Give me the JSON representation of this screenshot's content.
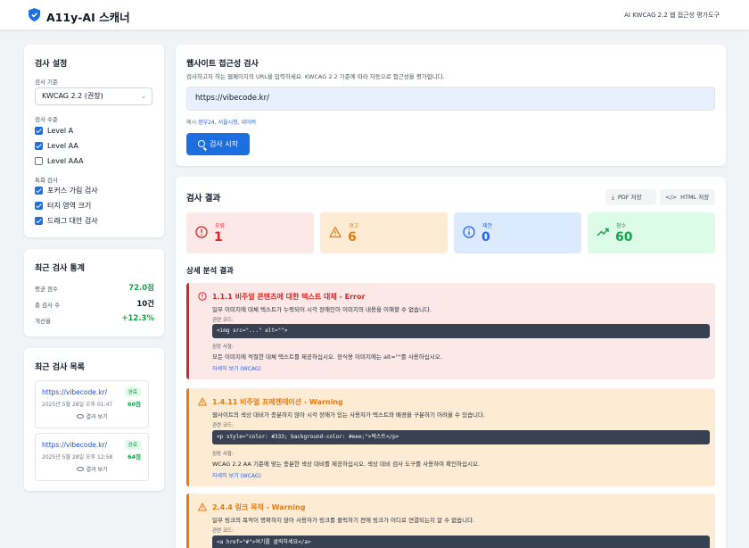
{
  "header": {
    "title": "A11y-AI 스캐너",
    "subtitle": "AI KWCAG 2.2 웹 접근성 평가도구"
  },
  "settings": {
    "title": "검사 설정",
    "standard_label": "검사 기준",
    "standard_value": "KWCAG 2.2 (권장)",
    "level_label": "검사 수준",
    "levels": [
      {
        "label": "Level A",
        "checked": true
      },
      {
        "label": "Level AA",
        "checked": true
      },
      {
        "label": "Level AAA",
        "checked": false
      }
    ],
    "special_label": "특화 검사",
    "specials": [
      {
        "label": "포커스 가림 검사",
        "checked": true
      },
      {
        "label": "터치 영역 크기",
        "checked": true
      },
      {
        "label": "드래그 대안 검사",
        "checked": true
      }
    ]
  },
  "stats": {
    "title": "최근 검사 통계",
    "rows": [
      {
        "label": "평균 점수",
        "value": "72.0점",
        "color": "#16a34a"
      },
      {
        "label": "총 검사 수",
        "value": "10건",
        "color": "#111827"
      },
      {
        "label": "개선율",
        "value": "+12.3%",
        "color": "#16a34a"
      }
    ]
  },
  "history": {
    "title": "최근 검사 목록",
    "items": [
      {
        "url": "https://vibecode.kr/",
        "badge": "완료",
        "date": "2025년 5월 28일 오후 01:47",
        "score": "60점",
        "view": "결과 보기"
      },
      {
        "url": "https://vibecode.kr/",
        "badge": "완료",
        "date": "2025년 5월 28일 오후 12:58",
        "score": "64점",
        "view": "결과 보기"
      }
    ]
  },
  "scan": {
    "title": "웹사이트 접근성 검사",
    "description": "검사하고자 하는 웹페이지의 URL을 입력하세요. KWCAG 2.2 기준에 따라 자동으로 접근성을 평가합니다.",
    "url_value": "https://vibecode.kr/",
    "examples_prefix": "예시:",
    "examples": [
      "정부24",
      "서울시청",
      "네이버"
    ],
    "button": "검사 시작"
  },
  "results": {
    "title": "검사 결과",
    "pdf_button": "PDF 저장",
    "html_button": "HTML 저장",
    "summary": [
      {
        "label": "오류",
        "value": "1",
        "bg": "#fde8e8",
        "fg": "#dc2626",
        "icon": "error-circle-icon"
      },
      {
        "label": "경고",
        "value": "6",
        "bg": "#fdebd3",
        "fg": "#ea7a0c",
        "icon": "warning-triangle-icon"
      },
      {
        "label": "제안",
        "value": "0",
        "bg": "#dbeafe",
        "fg": "#2563eb",
        "icon": "info-circle-icon"
      },
      {
        "label": "점수",
        "value": "60",
        "bg": "#dcfce7",
        "fg": "#16a34a",
        "icon": "trending-up-icon"
      }
    ],
    "detail_title": "상세 분석 결과",
    "issues": [
      {
        "title": "1.1.1 비주얼 콘텐츠에 대한 텍스트 대체 - Error",
        "desc": "일부 이미지에 대체 텍스트가 누락되어 시각 장애인이 이미지의 내용을 이해할 수 없습니다.",
        "code_label": "관련 코드:",
        "code": "<img src=\"...\" alt=\"\">",
        "rec_label": "권장 사항:",
        "rec": "모든 이미지에 적절한 대체 텍스트를 제공하십시오. 장식용 이미지에는 alt=\"\"를 사용하십시오.",
        "link": "자세히 보기 (WCAG)",
        "color": "#dc2626",
        "bg": "#fde8e8"
      },
      {
        "title": "1.4.11 비주얼 프레젠테이션 - Warning",
        "desc": "웹사이트의 색상 대비가 충분하지 않아 시각 장애가 있는 사용자가 텍스트와 배경을 구분하기 어려울 수 있습니다.",
        "code_label": "관련 코드:",
        "code": "<p style=\"color: #333; background-color: #eee;\">텍스트</p>",
        "rec_label": "권장 사항:",
        "rec": "WCAG 2.2 AA 기준에 맞는 충분한 색상 대비를 제공하십시오. 색상 대비 검사 도구를 사용하여 확인하십시오.",
        "link": "자세히 보기 (WCAG)",
        "color": "#ea7a0c",
        "bg": "#fdebd3"
      },
      {
        "title": "2.4.4 링크 목적 - Warning",
        "desc": "일부 링크의 목적이 명확하지 않아 사용자가 링크를 클릭하기 전에 링크가 어디로 연결되는지 알 수 없습니다.",
        "code_label": "관련 코드:",
        "code": "<a href=\"#\">여기를 클릭하세요</a>",
        "color": "#ea7a0c",
        "bg": "#fdebd3"
      }
    ]
  }
}
